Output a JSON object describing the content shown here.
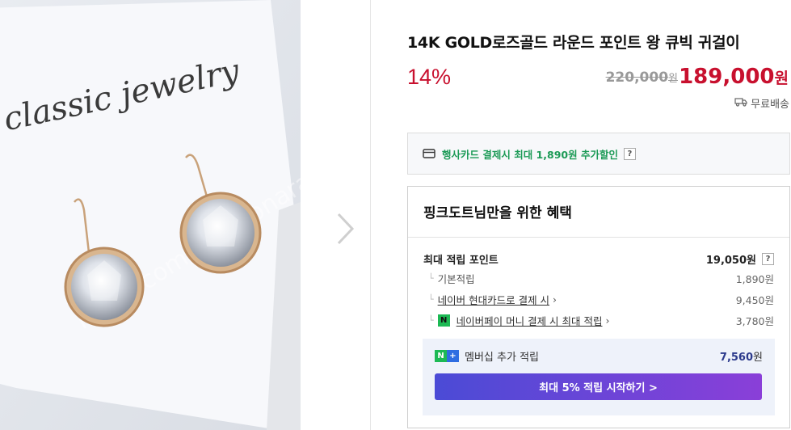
{
  "product": {
    "title": "14K GOLD로즈골드 라운드 포인트 왕 큐빅 귀걸이",
    "discount": "14%",
    "original_price": "220,000",
    "original_unit": "원",
    "sale_price": "189,000",
    "sale_unit": "원",
    "shipping": "무료배송"
  },
  "photo": {
    "card_text": "classic jewelry",
    "watermark": "naver.com/joongonara"
  },
  "card_promo": {
    "text": "행사카드 결제시 최대 1,890원 추가할인",
    "help": "?"
  },
  "benefit": {
    "header": "핑크도트님만을 위한 혜택",
    "max_point_label": "최대 적립 포인트",
    "max_point_value": "19,050원",
    "help": "?",
    "rows": [
      {
        "label": "기본적립",
        "value": "1,890원"
      },
      {
        "label": "네이버 현대카드로 결제 시",
        "value": "9,450원"
      },
      {
        "label": "네이버페이 머니 결제 시 최대 적립",
        "value": "3,780원"
      }
    ],
    "member": {
      "label": "멤버십 추가 적립",
      "value": "7,560",
      "unit": "원",
      "button": "최대 5% 적립 시작하기 >"
    }
  },
  "colors": {
    "price_red": "#c8102e",
    "promo_green": "#1c9a56",
    "member_blue": "#2c3a8c",
    "button_start": "#4b4bd6",
    "button_end": "#8a3fd8"
  },
  "icons": [
    "chevron-right-icon",
    "truck-icon",
    "credit-card-icon",
    "naverpay-icon",
    "nplus-icon"
  ]
}
